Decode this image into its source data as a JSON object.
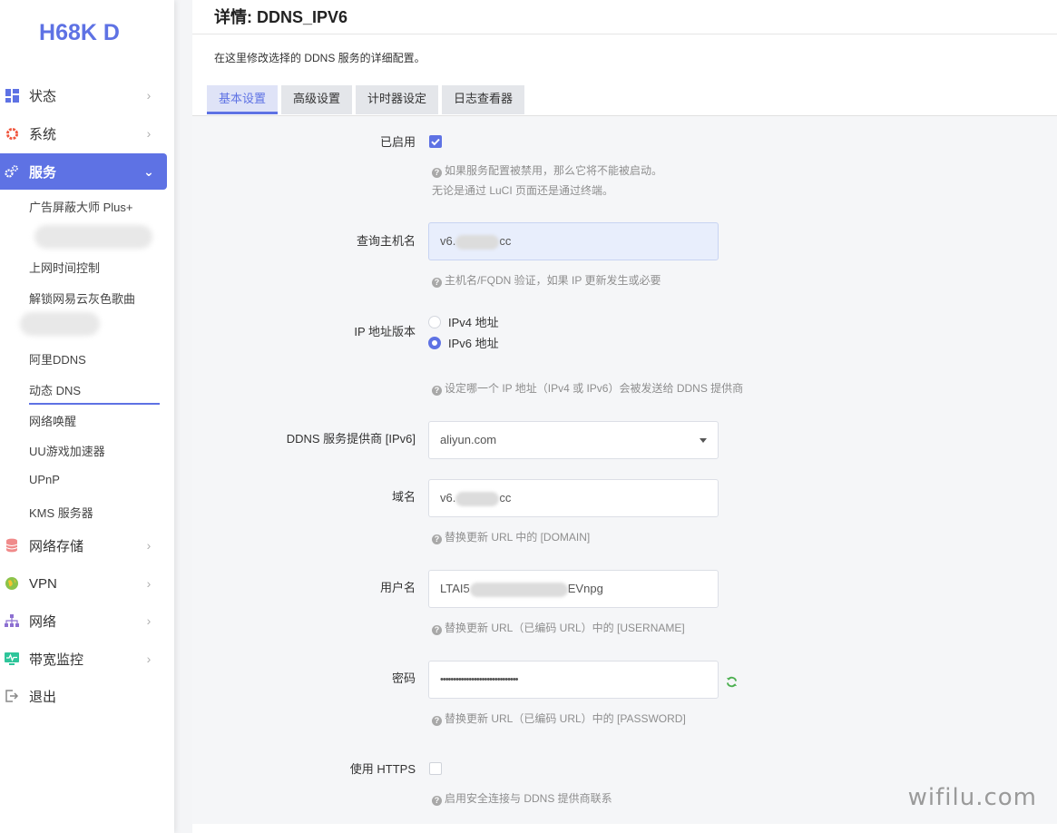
{
  "brand": "H68K D",
  "sidebar": {
    "menu": [
      {
        "label": "状态",
        "icon": "dashboard-icon"
      },
      {
        "label": "系统",
        "icon": "gear-icon"
      },
      {
        "label": "服务",
        "icon": "gears-icon"
      },
      {
        "label": "网络存储",
        "icon": "database-icon"
      },
      {
        "label": "VPN",
        "icon": "globe-icon"
      },
      {
        "label": "网络",
        "icon": "sitemap-icon"
      },
      {
        "label": "带宽监控",
        "icon": "monitor-icon"
      },
      {
        "label": "退出",
        "icon": "logout-icon"
      }
    ],
    "submenu": [
      {
        "label": "广告屏蔽大师 Plus+"
      },
      {
        "label": "上网时间控制"
      },
      {
        "label": "解锁网易云灰色歌曲"
      },
      {
        "label": "阿里DDNS"
      },
      {
        "label": "动态 DNS"
      },
      {
        "label": "网络唤醒"
      },
      {
        "label": "UU游戏加速器"
      },
      {
        "label": "UPnP"
      },
      {
        "label": "KMS 服务器"
      }
    ]
  },
  "main": {
    "title": "详情: DDNS_IPV6",
    "description": "在这里修改选择的 DDNS 服务的详细配置。",
    "tabs": [
      {
        "label": "基本设置"
      },
      {
        "label": "高级设置"
      },
      {
        "label": "计时器设定"
      },
      {
        "label": "日志查看器"
      }
    ],
    "form": {
      "enabled": {
        "label": "已启用",
        "checked": true,
        "hint1": "如果服务配置被禁用，那么它将不能被启动。",
        "hint2": "无论是通过 LuCI 页面还是通过终端。"
      },
      "lookup_host": {
        "label": "查询主机名",
        "value_prefix": "v6.",
        "value_suffix": "cc",
        "hint": "主机名/FQDN 验证，如果 IP 更新发生或必要"
      },
      "ip_version": {
        "label": "IP 地址版本",
        "options": [
          "IPv4 地址",
          "IPv6 地址"
        ],
        "selected": "IPv6 地址",
        "hint": "设定哪一个 IP 地址（IPv4 或 IPv6）会被发送给 DDNS 提供商"
      },
      "provider": {
        "label": "DDNS 服务提供商 [IPv6]",
        "value": "aliyun.com"
      },
      "domain": {
        "label": "域名",
        "value_prefix": "v6.",
        "value_suffix": "cc",
        "hint": "替换更新 URL 中的 [DOMAIN]"
      },
      "username": {
        "label": "用户名",
        "value_prefix": "LTAI5",
        "value_suffix": "EVnpg",
        "hint": "替换更新 URL（已编码 URL）中的 [USERNAME]"
      },
      "password": {
        "label": "密码",
        "value": "••••••••••••••••••••••••••••••",
        "hint": "替换更新 URL（已编码 URL）中的 [PASSWORD]"
      },
      "use_https": {
        "label": "使用 HTTPS",
        "checked": false,
        "hint": "启用安全连接与 DDNS 提供商联系"
      }
    }
  },
  "watermark": "wifilu.com",
  "colors": {
    "accent": "#5e72e4",
    "hint": "#8e8e8e"
  }
}
